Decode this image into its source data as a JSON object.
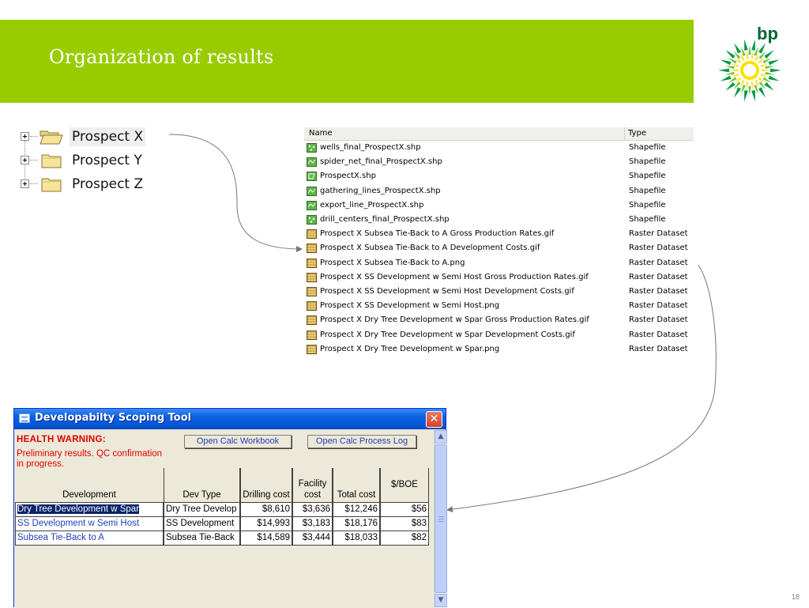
{
  "slide": {
    "title": "Organization of results",
    "logo_text": "bp",
    "page_number": "18"
  },
  "colors": {
    "header_green": "#99cc00",
    "bp_green": "#006633",
    "bp_yellow": "#ffdd00",
    "warning_red": "#e00000",
    "link_blue": "#1f3fbf",
    "selection_navy": "#0a246a"
  },
  "tree": {
    "items": [
      {
        "label": "Prospect X",
        "icon": "folder-open-icon"
      },
      {
        "label": "Prospect Y",
        "icon": "folder-icon"
      },
      {
        "label": "Prospect Z",
        "icon": "folder-icon"
      }
    ]
  },
  "file_list": {
    "columns": {
      "name": "Name",
      "type": "Type"
    },
    "rows": [
      {
        "name": "wells_final_ProspectX.shp",
        "type": "Shapefile",
        "icon": "point-shapefile-icon"
      },
      {
        "name": "spider_net_final_ProspectX.shp",
        "type": "Shapefile",
        "icon": "line-shapefile-icon"
      },
      {
        "name": "ProspectX.shp",
        "type": "Shapefile",
        "icon": "polygon-shapefile-icon"
      },
      {
        "name": "gathering_lines_ProspectX.shp",
        "type": "Shapefile",
        "icon": "line-shapefile-icon"
      },
      {
        "name": "export_line_ProspectX.shp",
        "type": "Shapefile",
        "icon": "line-shapefile-icon"
      },
      {
        "name": "drill_centers_final_ProspectX.shp",
        "type": "Shapefile",
        "icon": "point-shapefile-icon"
      },
      {
        "name": "Prospect X Subsea Tie-Back to A Gross Production Rates.gif",
        "type": "Raster Dataset",
        "icon": "raster-icon"
      },
      {
        "name": "Prospect X Subsea Tie-Back to A Development Costs.gif",
        "type": "Raster Dataset",
        "icon": "raster-icon"
      },
      {
        "name": "Prospect X Subsea Tie-Back to A.png",
        "type": "Raster Dataset",
        "icon": "raster-icon"
      },
      {
        "name": "Prospect X SS Development w Semi Host Gross Production Rates.gif",
        "type": "Raster Dataset",
        "icon": "raster-icon"
      },
      {
        "name": "Prospect X SS Development w Semi Host Development Costs.gif",
        "type": "Raster Dataset",
        "icon": "raster-icon"
      },
      {
        "name": "Prospect X SS Development w Semi Host.png",
        "type": "Raster Dataset",
        "icon": "raster-icon"
      },
      {
        "name": "Prospect X Dry Tree Development w Spar Gross Production Rates.gif",
        "type": "Raster Dataset",
        "icon": "raster-icon"
      },
      {
        "name": "Prospect X Dry Tree Development w Spar Development Costs.gif",
        "type": "Raster Dataset",
        "icon": "raster-icon"
      },
      {
        "name": "Prospect X Dry Tree Development w  Spar.png",
        "type": "Raster Dataset",
        "icon": "raster-icon"
      }
    ]
  },
  "dialog": {
    "title": "Developabilty Scoping Tool",
    "close_label": "✕",
    "health_title": "HEALTH WARNING:",
    "health_text": "Preliminary results. QC confirmation in progress.",
    "buttons": {
      "open_workbook": "Open Calc Workbook",
      "open_log": "Open Calc Process Log"
    },
    "grid": {
      "headers": {
        "development": "Development",
        "dev_type": "Dev Type",
        "drilling_cost": "Drilling cost",
        "facility_cost": "Facility cost",
        "total_cost": "Total cost",
        "per_boe": "$/BOE"
      },
      "rows": [
        {
          "development": "Dry Tree Development w Spar",
          "dev_type": "Dry Tree Develop",
          "drilling_cost": "$8,610",
          "facility_cost": "$3,636",
          "total_cost": "$12,246",
          "per_boe": "$56",
          "selected": true
        },
        {
          "development": "SS Development w Semi Host",
          "dev_type": "SS Development",
          "drilling_cost": "$14,993",
          "facility_cost": "$3,183",
          "total_cost": "$18,176",
          "per_boe": "$83",
          "selected": false
        },
        {
          "development": "Subsea Tie-Back to  A",
          "dev_type": "Subsea Tie-Back",
          "drilling_cost": "$14,589",
          "facility_cost": "$3,444",
          "total_cost": "$18,033",
          "per_boe": "$82",
          "selected": false
        }
      ]
    },
    "scroll": {
      "up_arrow": "▲",
      "down_arrow": "▼"
    }
  }
}
